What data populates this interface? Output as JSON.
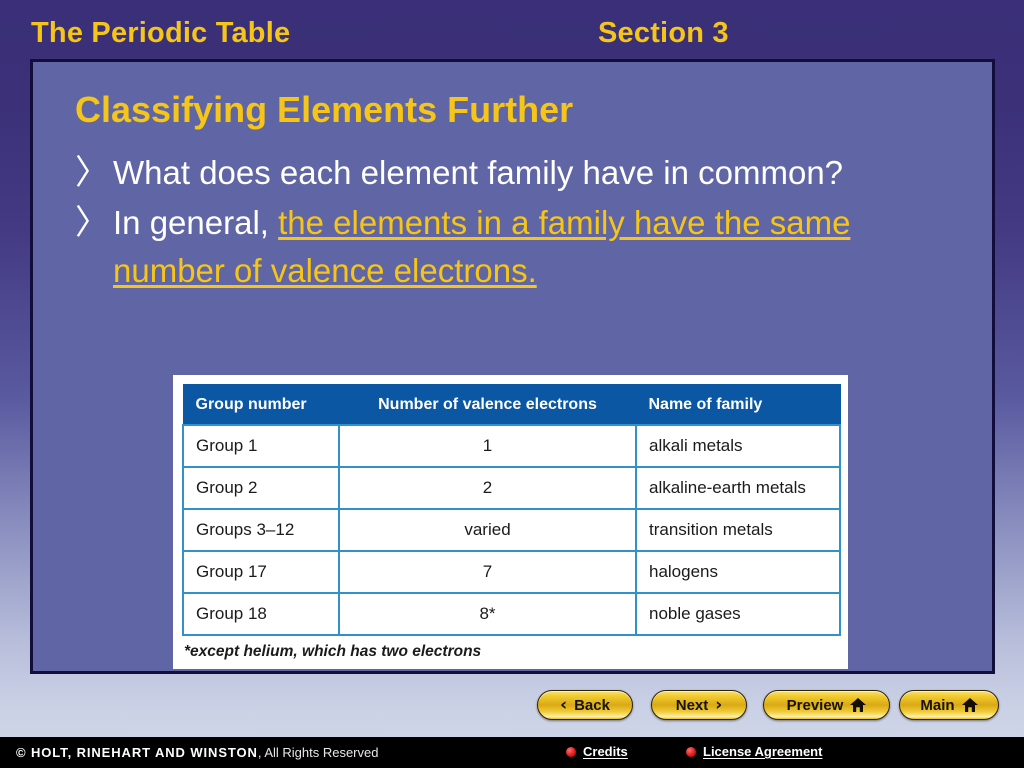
{
  "header": {
    "title": "The Periodic Table",
    "section": "Section 3"
  },
  "slide": {
    "title": "Classifying Elements Further",
    "bullet_marker": "〉",
    "bullets": [
      {
        "plain": "What does each element family have in common?",
        "emphasis": ""
      },
      {
        "plain": "In general, ",
        "emphasis": "the elements in a family have the same number of valence electrons."
      }
    ]
  },
  "table": {
    "headers": [
      "Group number",
      "Number of valence electrons",
      "Name of family"
    ],
    "rows": [
      [
        "Group 1",
        "1",
        "alkali metals"
      ],
      [
        "Group 2",
        "2",
        "alkaline-earth metals"
      ],
      [
        "Groups 3–12",
        "varied",
        "transition metals"
      ],
      [
        "Group 17",
        "7",
        "halogens"
      ],
      [
        "Group 18",
        "8*",
        "noble gases"
      ]
    ],
    "footnote": "*except helium, which has two electrons"
  },
  "nav": {
    "back": "Back",
    "next": "Next",
    "preview": "Preview",
    "main": "Main",
    "back_chevron": "‹",
    "next_chevron": "›"
  },
  "footer": {
    "copyright_strong": "© HOLT, RINEHART AND WINSTON",
    "copyright_rest": ", All Rights Reserved",
    "credits": "Credits",
    "license": "License Agreement"
  },
  "colors": {
    "accent_gold": "#f5c518",
    "panel": "#6065a6",
    "panel_border": "#120d3a",
    "table_header": "#0b57a4",
    "table_grid": "#3191c9",
    "footer_bg": "#000000",
    "link_dot": "#e01b1b"
  }
}
